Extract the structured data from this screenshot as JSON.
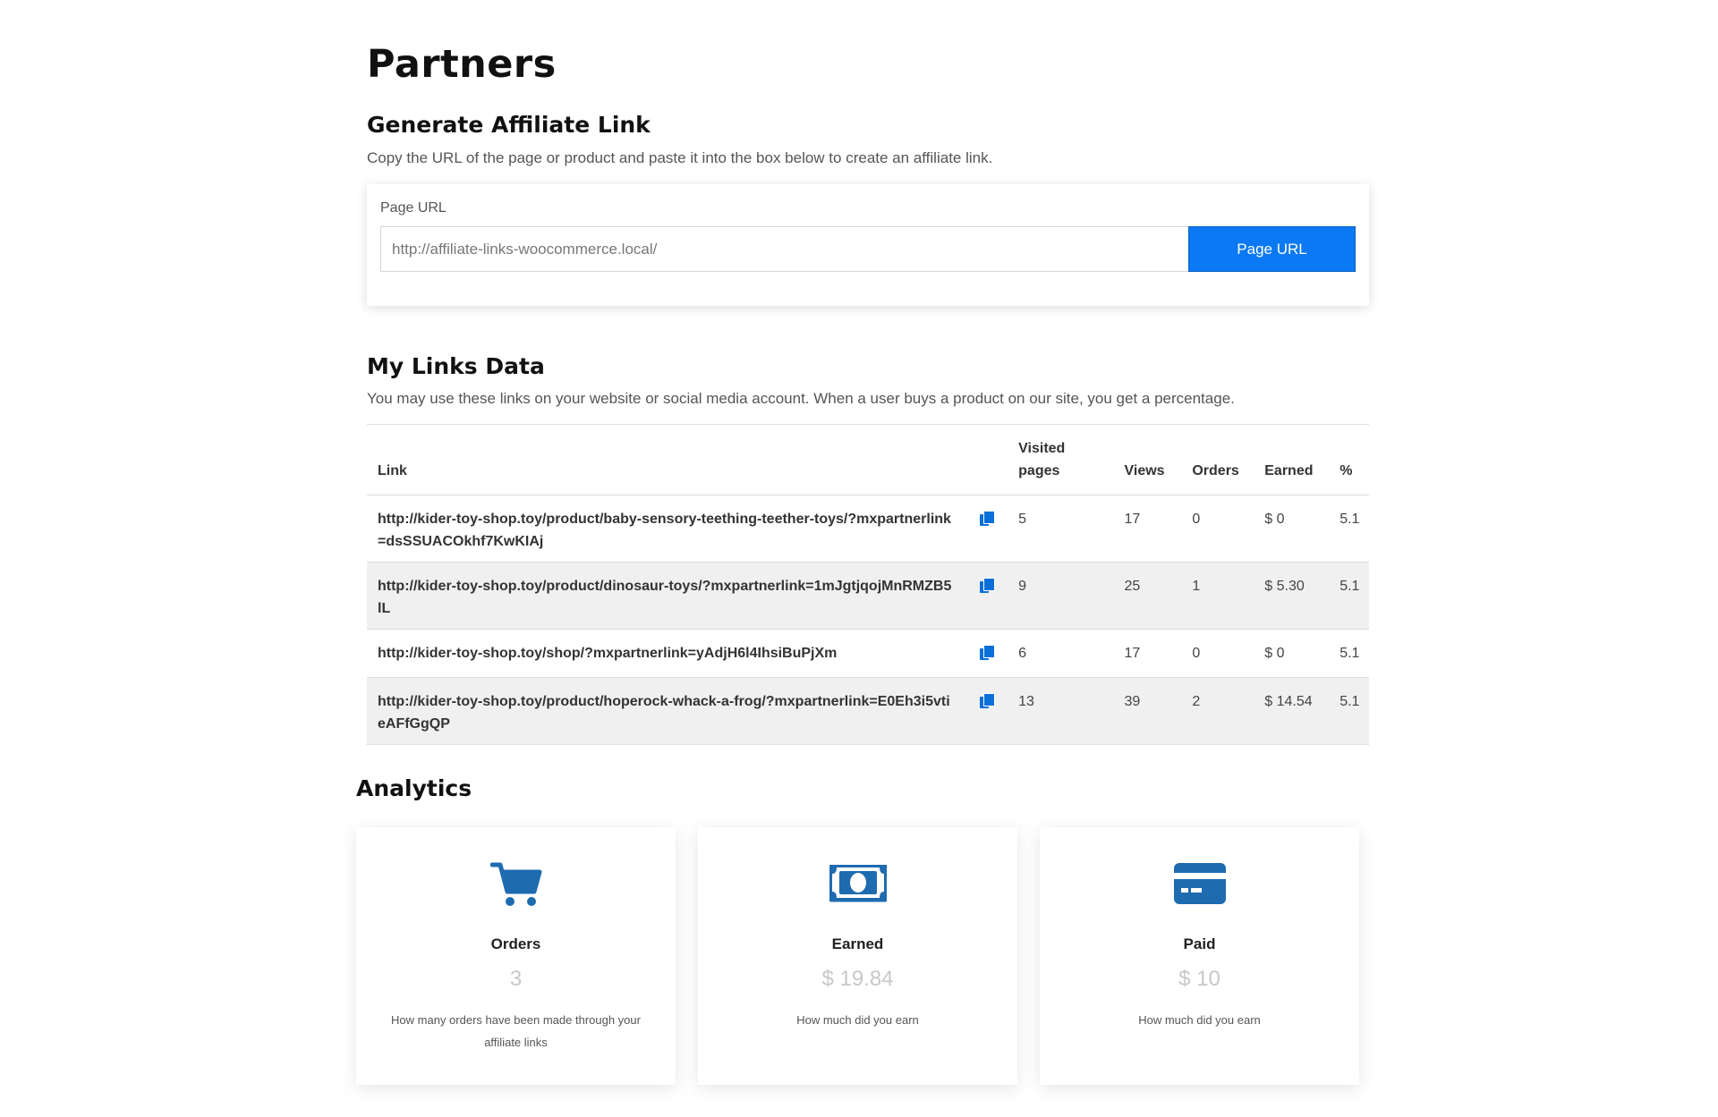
{
  "page": {
    "title": "Partners"
  },
  "generate": {
    "title": "Generate Affiliate Link",
    "description": "Copy the URL of the page or product and paste it into the box below to create an affiliate link.",
    "field_label": "Page URL",
    "input_placeholder": "http://affiliate-links-woocommerce.local/",
    "button_label": "Page URL"
  },
  "links": {
    "title": "My Links Data",
    "description": "You may use these links on your website or social media account. When a user buys a product on our site, you get a percentage.",
    "columns": {
      "link": "Link",
      "visited_pages": "Visited pages",
      "views": "Views",
      "orders": "Orders",
      "earned": "Earned",
      "percent": "%"
    },
    "rows": [
      {
        "link": "http://kider-toy-shop.toy/product/baby-sensory-teething-teether-toys/?mxpartnerlink=dsSSUACOkhf7KwKIAj",
        "visited_pages": "5",
        "views": "17",
        "orders": "0",
        "earned": "$ 0",
        "percent": "5.1"
      },
      {
        "link": "http://kider-toy-shop.toy/product/dinosaur-toys/?mxpartnerlink=1mJgtjqojMnRMZB5lL",
        "visited_pages": "9",
        "views": "25",
        "orders": "1",
        "earned": "$ 5.30",
        "percent": "5.1"
      },
      {
        "link": "http://kider-toy-shop.toy/shop/?mxpartnerlink=yAdjH6l4IhsiBuPjXm",
        "visited_pages": "6",
        "views": "17",
        "orders": "0",
        "earned": "$ 0",
        "percent": "5.1"
      },
      {
        "link": "http://kider-toy-shop.toy/product/hoperock-whack-a-frog/?mxpartnerlink=E0Eh3i5vtieAFfGgQP",
        "visited_pages": "13",
        "views": "39",
        "orders": "2",
        "earned": "$ 14.54",
        "percent": "5.1"
      }
    ],
    "copy_icon": "copy-icon"
  },
  "analytics": {
    "title": "Analytics",
    "accent_color": "#1e6bb0",
    "cards": [
      {
        "icon": "cart-icon",
        "label": "Orders",
        "value": "3",
        "description": "How many orders have been made through your affiliate links"
      },
      {
        "icon": "money-icon",
        "label": "Earned",
        "value": "$ 19.84",
        "description": "How much did you earn"
      },
      {
        "icon": "credit-card-icon",
        "label": "Paid",
        "value": "$ 10",
        "description": "How much did you earn"
      }
    ]
  },
  "colors": {
    "primary_button": "#0b79f4",
    "copy_icon": "#0b6fd8",
    "striped_row": "#f0f0f0"
  }
}
